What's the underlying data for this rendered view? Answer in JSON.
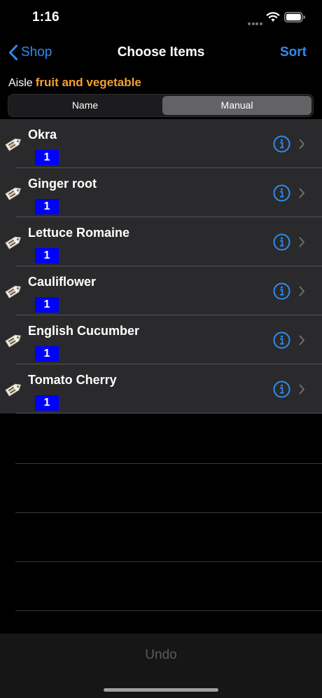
{
  "status": {
    "time": "1:16"
  },
  "nav": {
    "back_label": "Shop",
    "title": "Choose Items",
    "sort_label": "Sort"
  },
  "aisle": {
    "prefix": "Aisle",
    "name": "fruit and vegetable"
  },
  "segmented": {
    "options": [
      "Name",
      "Manual"
    ],
    "selected": "Manual"
  },
  "items": [
    {
      "name": "Okra",
      "quantity": "1"
    },
    {
      "name": "Ginger root",
      "quantity": "1"
    },
    {
      "name": "Lettuce Romaine",
      "quantity": "1"
    },
    {
      "name": "Cauliflower",
      "quantity": "1"
    },
    {
      "name": "English Cucumber",
      "quantity": "1"
    },
    {
      "name": "Tomato Cherry",
      "quantity": "1"
    }
  ],
  "toolbar": {
    "undo_label": "Undo"
  },
  "colors": {
    "accent": "#2f8cf0",
    "aisle": "#f5a030",
    "badge": "#0000ff"
  },
  "icons": {
    "back": "chevron-left-icon",
    "item": "price-tag-icon",
    "info": "info-circle-icon",
    "disclosure": "chevron-right-icon"
  }
}
